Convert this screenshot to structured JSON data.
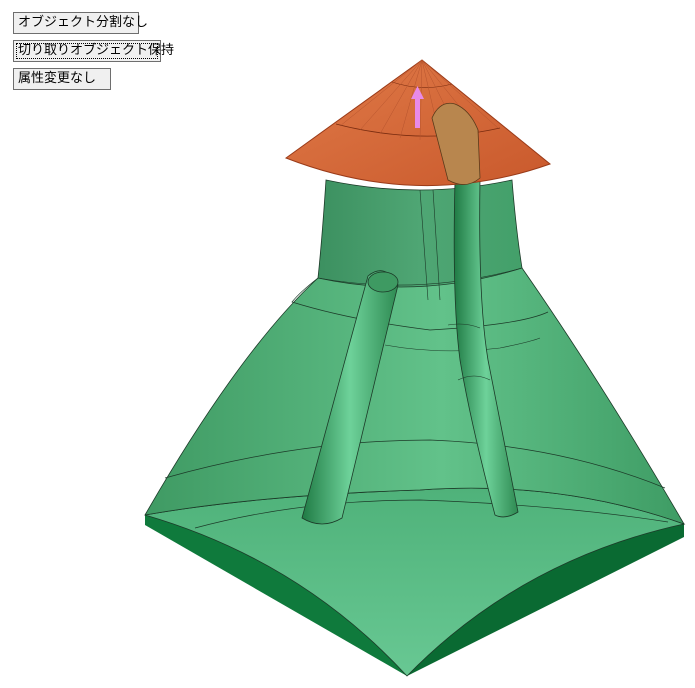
{
  "options": {
    "no_split_label": "オブジェクト分割なし",
    "keep_cut_label": "切り取りオブジェクト保持",
    "no_attr_change_label": "属性変更なし"
  },
  "colors": {
    "model_green": "#4db37a",
    "model_dark_green": "#0e6e36",
    "cap_orange": "#d86a3a",
    "arrow_pink": "#e88ae8"
  }
}
